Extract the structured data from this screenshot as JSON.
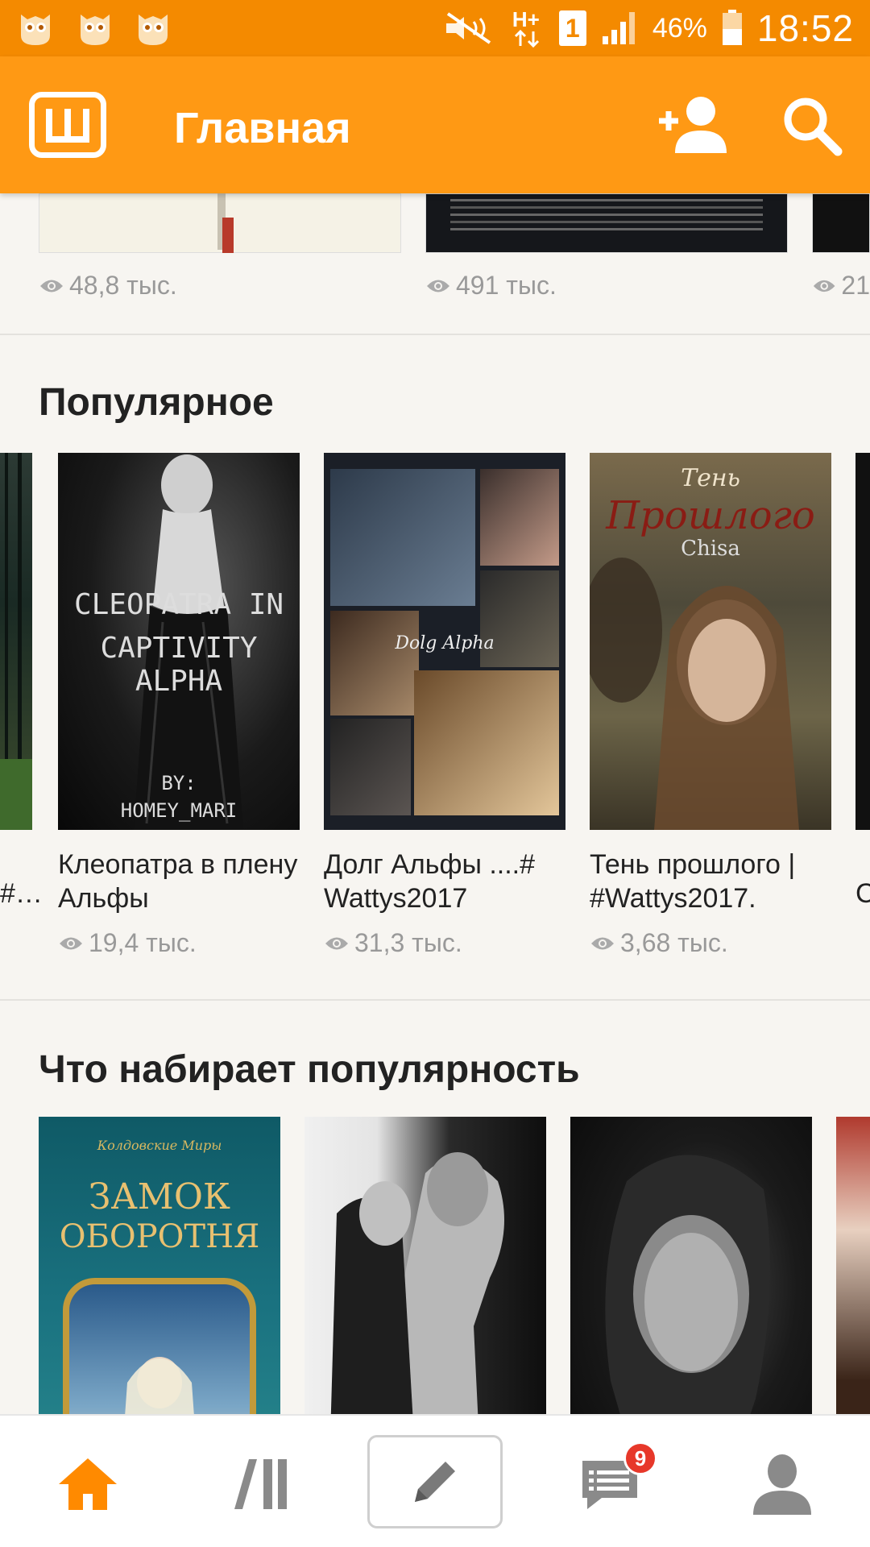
{
  "status_bar": {
    "battery_percent": "46%",
    "time": "18:52",
    "network_type": "H+",
    "sim_slot": "1",
    "icons": [
      "owl-icon",
      "owl-icon",
      "owl-icon",
      "mute-icon",
      "network-icon",
      "sim-icon",
      "signal-icon",
      "battery-icon"
    ]
  },
  "app_bar": {
    "title": "Главная",
    "icons": [
      "wattpad-logo-icon",
      "add-user-icon",
      "search-icon"
    ]
  },
  "top_row": {
    "items": [
      {
        "views": "48,8 тыс."
      },
      {
        "views": "491 тыс."
      },
      {
        "views": "21"
      }
    ]
  },
  "popular": {
    "title": "Популярное",
    "items": [
      {
        "title": "Клеопатра в плену Альфы",
        "views": "19,4 тыс.",
        "cover_text": [
          "CLEOPATRA IN",
          "CAPTIVITY ALPHA",
          "BY:",
          "HOMEY_MARI"
        ]
      },
      {
        "title": "Долг Альфы ....# Wattys2017",
        "views": "31,3 тыс.",
        "cover_text": [
          "Dolg Alpha"
        ]
      },
      {
        "title": "Тень прошлого | #Wattys2017.",
        "views": "3,68 тыс.",
        "cover_text": [
          "Тень",
          "Прошлого",
          "Chisa"
        ]
      }
    ]
  },
  "trending": {
    "title": "Что набирает популярность",
    "items": [
      {
        "cover_text": [
          "Колдовские Миры",
          "ЗАМОК",
          "ОБОРОТНЯ"
        ]
      },
      {
        "cover_text": []
      },
      {
        "cover_text": []
      }
    ]
  },
  "bottom_nav": {
    "badge_count": "9",
    "items": [
      "home-icon",
      "library-icon",
      "write-icon",
      "messages-icon",
      "profile-icon"
    ]
  },
  "colors": {
    "status_bar": "#f48a00",
    "app_bar": "#ff9914",
    "accent": "#ff8a00",
    "badge": "#e7382a"
  }
}
